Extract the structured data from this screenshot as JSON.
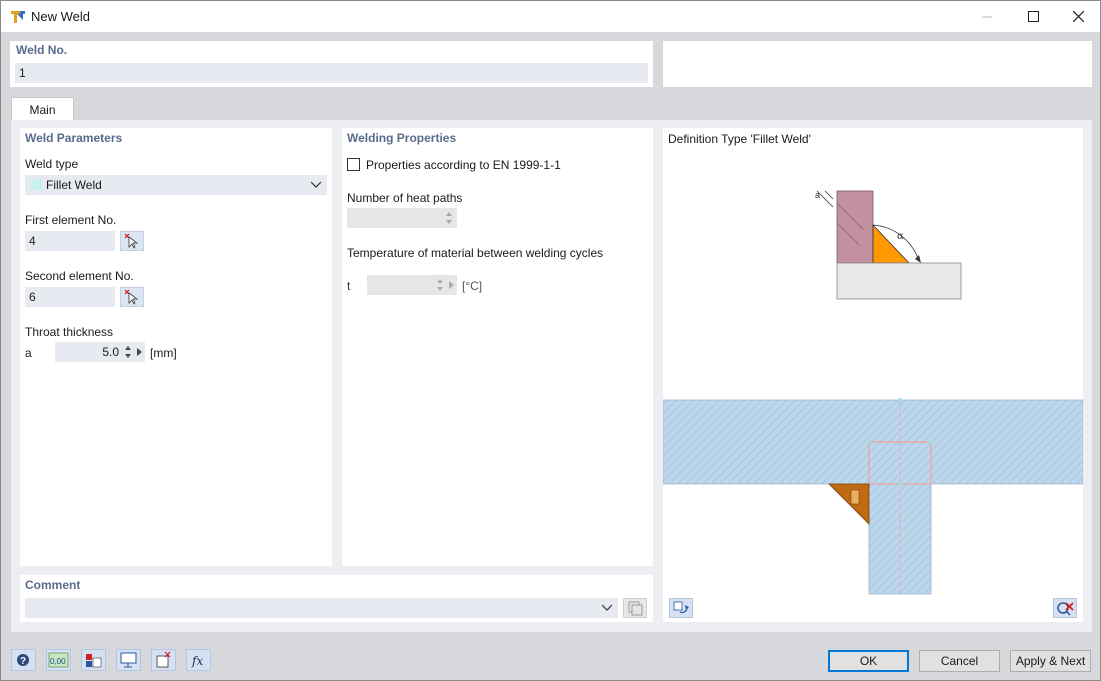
{
  "window": {
    "title": "New Weld"
  },
  "weld_no": {
    "label": "Weld No.",
    "value": "1"
  },
  "tabs": [
    {
      "label": "Main"
    }
  ],
  "weld_parameters": {
    "title": "Weld Parameters",
    "weld_type_label": "Weld type",
    "weld_type_value": "Fillet Weld",
    "weld_type_color": "#c8f0f0",
    "first_element_label": "First element No.",
    "first_element_value": "4",
    "second_element_label": "Second element No.",
    "second_element_value": "6",
    "throat_label": "Throat thickness",
    "throat_symbol": "a",
    "throat_value": "5.0",
    "throat_unit": "[mm]"
  },
  "welding_properties": {
    "title": "Welding Properties",
    "en_checkbox_label": "Properties according to EN 1999-1-1",
    "en_checked": false,
    "heat_paths_label": "Number of heat paths",
    "heat_paths_value": "",
    "temperature_label": "Temperature of material between welding cycles",
    "temperature_symbol": "t",
    "temperature_value": "",
    "temperature_unit": "[°C]"
  },
  "definition": {
    "title": "Definition Type 'Fillet Weld'",
    "label_a": "a",
    "label_alpha": "α"
  },
  "comment": {
    "label": "Comment",
    "value": ""
  },
  "buttons": {
    "ok": "OK",
    "cancel": "Cancel",
    "apply_next": "Apply & Next"
  },
  "toolbar": {
    "units_value": "0,00"
  },
  "colors": {
    "section_title": "#5a6b8c",
    "field_bg": "#e8eaf2",
    "weld_orange": "#ff9900",
    "element_mauve": "#c2909f",
    "preview_blue": "#bcd6ec",
    "weld_brown": "#c06a14",
    "ok_border": "#0078d7"
  }
}
